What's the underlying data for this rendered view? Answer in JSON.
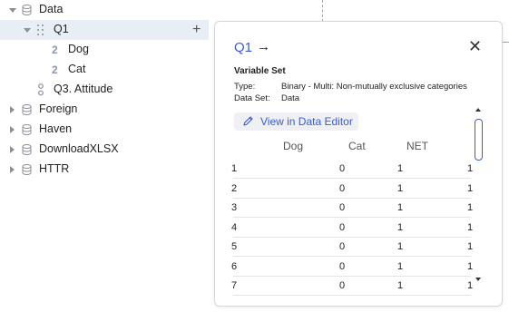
{
  "tree": {
    "data": {
      "label": "Data"
    },
    "q1": {
      "label": "Q1",
      "plus": "+"
    },
    "dog": {
      "num": "2",
      "label": "Dog"
    },
    "cat": {
      "num": "2",
      "label": "Cat"
    },
    "q3": {
      "label": "Q3. Attitude"
    },
    "foreign": {
      "label": "Foreign"
    },
    "haven": {
      "label": "Haven"
    },
    "download": {
      "label": "DownloadXLSX"
    },
    "httr": {
      "label": "HTTR"
    }
  },
  "card": {
    "title": "Q1",
    "arrow": "→",
    "close": "✕",
    "section": "Variable Set",
    "type_label": "Type:",
    "type_value": "Binary - Multi: Non-mutually exclusive categories",
    "dataset_label": "Data Set:",
    "dataset_value": "Data",
    "view_button": "View in Data Editor",
    "columns": [
      "Dog",
      "Cat",
      "NET"
    ],
    "rows": [
      {
        "id": "1",
        "dog": "0",
        "cat": "1",
        "net": "1"
      },
      {
        "id": "2",
        "dog": "0",
        "cat": "1",
        "net": "1"
      },
      {
        "id": "3",
        "dog": "0",
        "cat": "1",
        "net": "1"
      },
      {
        "id": "4",
        "dog": "0",
        "cat": "1",
        "net": "1"
      },
      {
        "id": "5",
        "dog": "0",
        "cat": "1",
        "net": "1"
      },
      {
        "id": "6",
        "dog": "0",
        "cat": "1",
        "net": "1"
      },
      {
        "id": "7",
        "dog": "0",
        "cat": "1",
        "net": "1"
      }
    ]
  },
  "colors": {
    "accent": "#3b5bd6",
    "selected_row": "#e9eef6",
    "icon": "#8a97ad"
  }
}
